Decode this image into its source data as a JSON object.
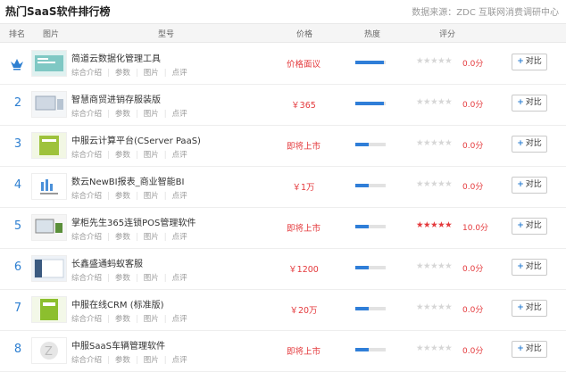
{
  "header": {
    "title": "热门SaaS软件排行榜",
    "source": "数据来源：ZDC 互联网消费调研中心"
  },
  "columns": {
    "rank": "排名",
    "image": "图片",
    "model": "型号",
    "price": "价格",
    "heat": "热度",
    "rating": "评分"
  },
  "links": [
    "综合介绍",
    "参数",
    "图片",
    "点评"
  ],
  "compare_label": "对比",
  "compare_icon": "plus-icon",
  "rank1_icon": "crown-icon",
  "colors": {
    "accent": "#2d7fd1",
    "price": "#e4393c",
    "heat": "#2f7ed8",
    "star_on": "#e4393c",
    "star_off": "#d6d6d6"
  },
  "rows": [
    {
      "rank": "1",
      "name": "简道云数据化管理工具",
      "price": "价格面议",
      "heat": 0.95,
      "stars": 0,
      "score": "0.0分"
    },
    {
      "rank": "2",
      "name": "智慧商贸进销存服装版",
      "price": "￥365",
      "heat": 0.95,
      "stars": 0,
      "score": "0.0分"
    },
    {
      "rank": "3",
      "name": "中服云计算平台(CServer PaaS)",
      "price": "即将上市",
      "heat": 0.45,
      "stars": 0,
      "score": "0.0分"
    },
    {
      "rank": "4",
      "name": "数云NewBI报表_商业智能BI",
      "price": "￥1万",
      "heat": 0.45,
      "stars": 0,
      "score": "0.0分"
    },
    {
      "rank": "5",
      "name": "掌柜先生365连锁POS管理软件",
      "price": "即将上市",
      "heat": 0.45,
      "stars": 5,
      "score": "10.0分"
    },
    {
      "rank": "6",
      "name": "长鑫盛通蚂蚁客服",
      "price": "￥1200",
      "heat": 0.45,
      "stars": 0,
      "score": "0.0分"
    },
    {
      "rank": "7",
      "name": "中服在线CRM (标准版)",
      "price": "￥20万",
      "heat": 0.45,
      "stars": 0,
      "score": "0.0分"
    },
    {
      "rank": "8",
      "name": "中服SaaS车辆管理软件",
      "price": "即将上市",
      "heat": 0.45,
      "stars": 0,
      "score": "0.0分"
    }
  ]
}
